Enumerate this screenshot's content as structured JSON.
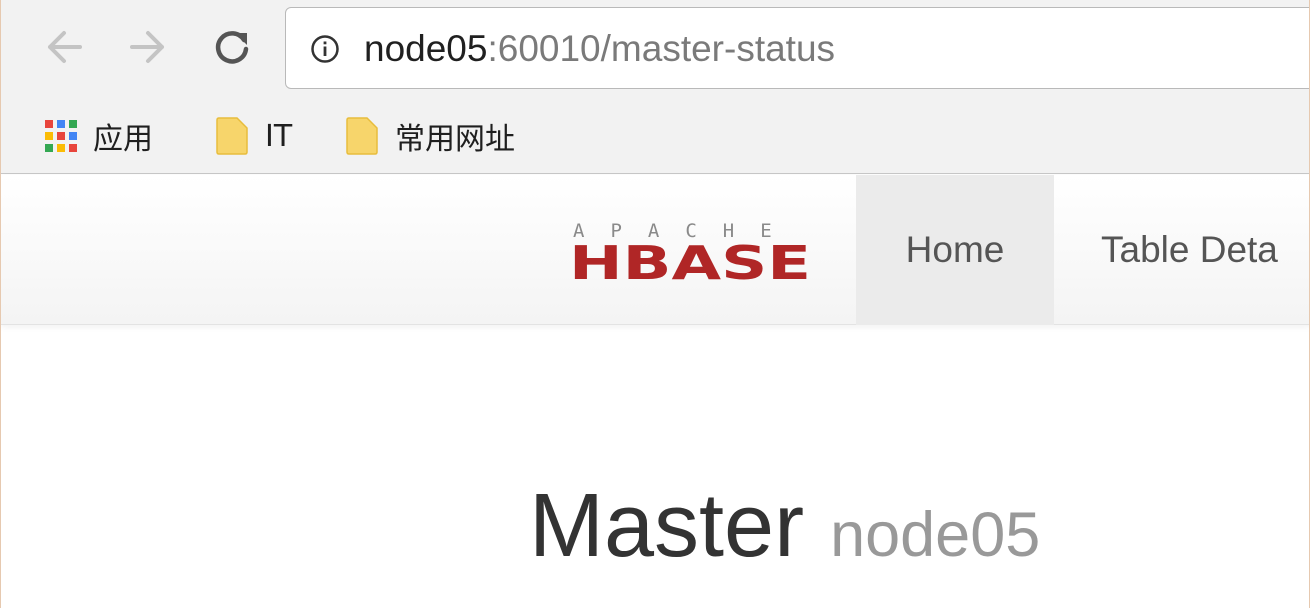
{
  "browser": {
    "url_host": "node05",
    "url_rest": ":60010/master-status"
  },
  "bookmarks": {
    "items": [
      {
        "label": "应用",
        "icon": "apps-grid-icon"
      },
      {
        "label": "IT",
        "icon": "folder-icon"
      },
      {
        "label": "常用网址",
        "icon": "folder-icon"
      }
    ]
  },
  "navbar": {
    "logo_top": "APACHE",
    "logo_main": "HBASE",
    "items": [
      {
        "label": "Home",
        "active": true
      },
      {
        "label": "Table Deta"
      }
    ]
  },
  "heading": {
    "title": "Master",
    "subtitle": "node05"
  },
  "colors": {
    "logo_red": "#b02626",
    "folder_yellow": "#f7d56b",
    "apps_colors": [
      "#e8453c",
      "#4285f4",
      "#34a853",
      "#fbbc05",
      "#e8453c",
      "#4285f4",
      "#34a853",
      "#fbbc05",
      "#e8453c"
    ]
  }
}
